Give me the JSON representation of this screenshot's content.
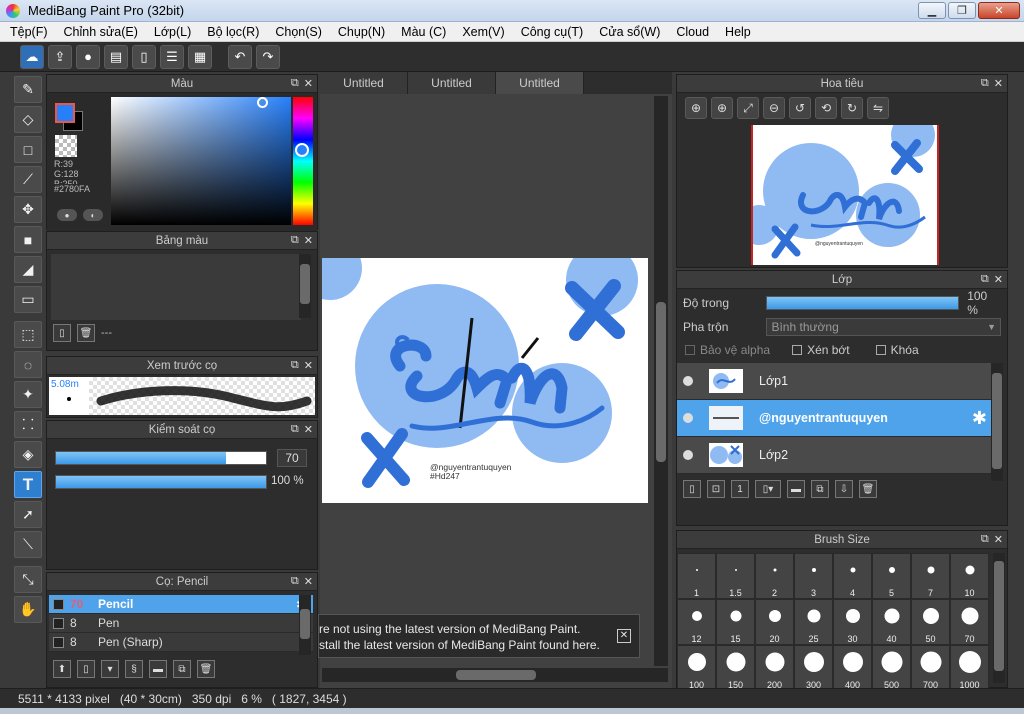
{
  "window": {
    "title": "MediBang Paint Pro (32bit)"
  },
  "menu": [
    "Tệp(F)",
    "Chỉnh sửa(E)",
    "Lớp(L)",
    "Bộ lọc(R)",
    "Chọn(S)",
    "Chụp(N)",
    "Màu (C)",
    "Xem(V)",
    "Công cụ(T)",
    "Cửa sổ(W)",
    "Cloud",
    "Help"
  ],
  "color_panel": {
    "title": "Màu",
    "r": "R:39",
    "g": "G:128",
    "b": "B:250",
    "hex": "#2780FA",
    "fg_color": "#2780fa"
  },
  "palette_panel": {
    "title": "Bảng màu",
    "name": "---"
  },
  "brush_preview_panel": {
    "title": "Xem trước cọ",
    "size": "5.08m"
  },
  "brush_control_panel": {
    "title": "Kiểm soát cọ",
    "size_value": "70",
    "opacity_value": "100 %",
    "size_fraction": 0.81,
    "opacity_fraction": 1.0
  },
  "brush_panel": {
    "title": "Cọ: Pencil",
    "items": [
      {
        "size": "70",
        "name": "Pencil"
      },
      {
        "size": "8",
        "name": "Pen"
      },
      {
        "size": "8",
        "name": "Pen (Sharp)"
      }
    ]
  },
  "canvas": {
    "tabs": [
      "Untitled",
      "Untitled",
      "Untitled"
    ],
    "art_handle": "@nguyentrantuquyen",
    "art_tag": "#Hd247",
    "notice_line1": "re not using the latest version of MediBang Paint.",
    "notice_line2": "stall the latest version of MediBang Paint found here."
  },
  "navigator_panel": {
    "title": "Hoa tiêu"
  },
  "layer_panel": {
    "title": "Lớp",
    "opacity_label": "Độ trong",
    "opacity_value": "100 %",
    "blend_label": "Pha trộn",
    "blend_value": "Bình thường",
    "protect_alpha": "Bảo vệ alpha",
    "clipping": "Xén bớt",
    "lock": "Khóa",
    "layers": [
      {
        "name": "Lớp1"
      },
      {
        "name": "@nguyentrantuquyen"
      },
      {
        "name": "Lớp2"
      }
    ]
  },
  "brush_size_panel": {
    "title": "Brush Size",
    "sizes": [
      "1",
      "1.5",
      "2",
      "3",
      "4",
      "5",
      "7",
      "10",
      "12",
      "15",
      "20",
      "25",
      "30",
      "40",
      "50",
      "70",
      "100",
      "150",
      "200",
      "300",
      "400",
      "500",
      "700",
      "1000"
    ]
  },
  "status": {
    "text": "5511 * 4133 pixel   (40 * 30cm)   350 dpi   6 %   ( 1827, 3454 )"
  },
  "colors": {
    "accent": "#4ea3ea",
    "art_blue": "#2f6fd6",
    "light_blue": "#8fbaf2",
    "dark": "#2d2d2d"
  }
}
